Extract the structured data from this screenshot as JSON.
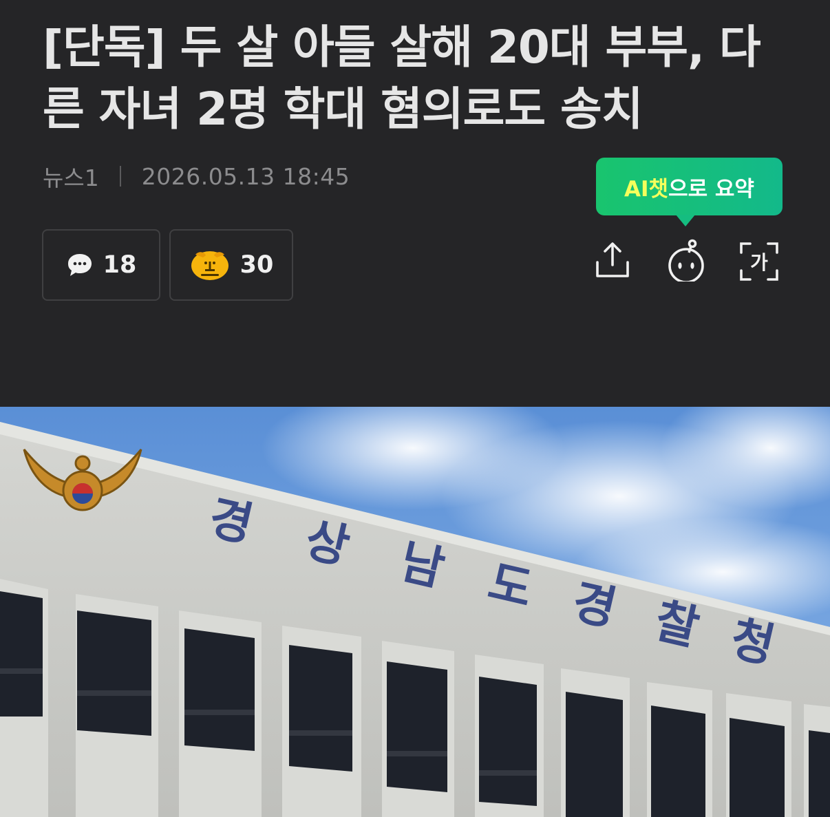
{
  "article": {
    "headline": "[단독] 두 살 아들 살해 20대 부부, 다른 자녀 2명 학대 혐의로도 송치",
    "source": "뉴스1",
    "timestamp": "2026.05.13 18:45"
  },
  "ai_summary": {
    "label_accent": "AI챗",
    "label_rest": "으로 요약",
    "accent_color": "#f5ff5c",
    "bubble_color": "#19c46e"
  },
  "stats": {
    "comments_count": "18",
    "reactions_count": "30"
  },
  "toolbar": {
    "share_icon": "share-upload-icon",
    "bot_icon": "ai-bot-icon",
    "font_icon": "font-size-icon",
    "font_glyph": "가"
  },
  "photo": {
    "building_sign": [
      "경",
      "상",
      "남",
      "도",
      "경",
      "찰",
      "청"
    ]
  },
  "colors": {
    "background": "#252527",
    "headline": "#e6e6e6",
    "meta": "#8c8c8e",
    "sign_letters": "#3a4a86"
  }
}
